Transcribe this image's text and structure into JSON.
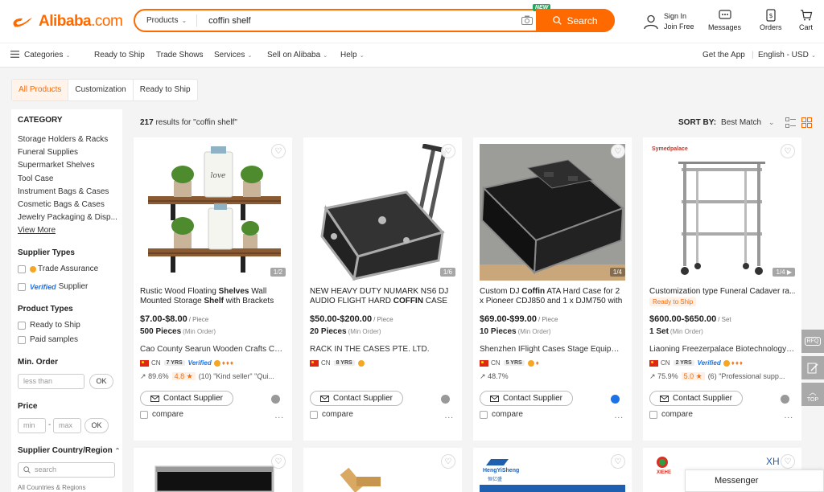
{
  "brand": {
    "logo_text": "Alibaba",
    "logo_suffix": ".com",
    "accent": "#ff6a00"
  },
  "search": {
    "category": "Products",
    "query": "coffin shelf",
    "new_badge": "NEW",
    "button": "Search"
  },
  "header": {
    "signin_line1": "Sign In",
    "signin_line2": "Join Free",
    "messages": "Messages",
    "orders": "Orders",
    "cart": "Cart"
  },
  "nav": {
    "categories": "Categories",
    "ready_to_ship": "Ready to Ship",
    "trade_shows": "Trade Shows",
    "services": "Services",
    "sell": "Sell on Alibaba",
    "help": "Help",
    "get_app": "Get the App",
    "lang_currency": "English - USD"
  },
  "tabs": [
    "All Products",
    "Customization",
    "Ready to Ship"
  ],
  "sidebar": {
    "category_title": "CATEGORY",
    "categories": [
      "Storage Holders & Racks",
      "Funeral Supplies",
      "Supermarket Shelves",
      "Tool Case",
      "Instrument Bags & Cases",
      "Cosmetic Bags & Cases",
      "Jewelry Packaging & Disp..."
    ],
    "view_more": "View More",
    "supplier_types_title": "Supplier Types",
    "trade_assurance": "Trade Assurance",
    "verified_label": "Verified",
    "verified_supplier": "Supplier",
    "product_types_title": "Product Types",
    "product_types": [
      "Ready to Ship",
      "Paid samples"
    ],
    "min_order_title": "Min. Order",
    "min_order_placeholder": "less than",
    "ok": "OK",
    "price_title": "Price",
    "price_min": "min",
    "price_sep": "-",
    "price_max": "max",
    "country_title": "Supplier Country/Region",
    "country_search": "search",
    "all_countries": "All Countries & Regions"
  },
  "results": {
    "count": "217",
    "text": " results for \"coffin shelf\""
  },
  "sort": {
    "label": "SORT BY:",
    "value": "Best Match"
  },
  "products": [
    {
      "title_parts": [
        "Rustic Wood Floating ",
        "Shelves",
        " Wall Mounted Storage ",
        "Shelf",
        " with Brackets"
      ],
      "pager": "1/2",
      "price": "$7.00-$8.00",
      "price_unit": "/ Piece",
      "moq": "500 Pieces",
      "moq_unit": "(Min Order)",
      "supplier": "Cao County Searun Wooden Crafts Co., ...",
      "country": "CN",
      "years": "7 YRS",
      "verified": "Verified",
      "response": "89.6%",
      "rating": "4.8 ★",
      "reviews": "(10)",
      "review_quote": "\"Kind seller\"  \"Qui..."
    },
    {
      "title_parts": [
        "NEW HEAVY DUTY NUMARK NS6 DJ AUDIO FLIGHT HARD ",
        "COFFIN",
        " CASE"
      ],
      "pager": "1/6",
      "price": "$50.00-$200.00",
      "price_unit": "/ Piece",
      "moq": "20 Pieces",
      "moq_unit": "(Min Order)",
      "supplier": "RACK IN THE CASES PTE. LTD.",
      "country": "CN",
      "years": "8 YRS"
    },
    {
      "title_parts": [
        "Custom DJ ",
        "Coffin",
        " ATA Hard Case for 2 x Pioneer CDJ850 and 1 x DJM750 with"
      ],
      "pager": "1/4",
      "price": "$69.00-$99.00",
      "price_unit": "/ Piece",
      "moq": "10 Pieces",
      "moq_unit": "(Min Order)",
      "supplier": "Shenzhen IFlight Cases Stage Equipme...",
      "country": "CN",
      "years": "5 YRS",
      "response": "48.7%"
    },
    {
      "title_parts": [
        "Customization type Funeral Cadaver ra..."
      ],
      "ready_badge": "Ready to Ship",
      "pager": "1/4",
      "price": "$600.00-$650.00",
      "price_unit": "/ Set",
      "moq": "1 Set",
      "moq_unit": "(Min Order)",
      "supplier": "Liaoning Freezerpalace Biotechnology ...",
      "country": "CN",
      "years": "2 YRS",
      "verified": "Verified",
      "response": "75.9%",
      "rating": "5.0 ★",
      "reviews": "(6)",
      "review_quote": "\"Professional supp...",
      "brand_mark": "Symedpalace"
    }
  ],
  "card_actions": {
    "contact": "Contact Supplier",
    "compare": "compare",
    "more": "..."
  },
  "row2_logos": {
    "hengyisheng": "HengYiSheng",
    "hengyisheng_cn": "恒亿盛",
    "xiehe": "XIEHE",
    "xh": "XH"
  },
  "right_tools": {
    "rfq": "RFQ",
    "top": "TOP"
  },
  "messenger": "Messenger"
}
